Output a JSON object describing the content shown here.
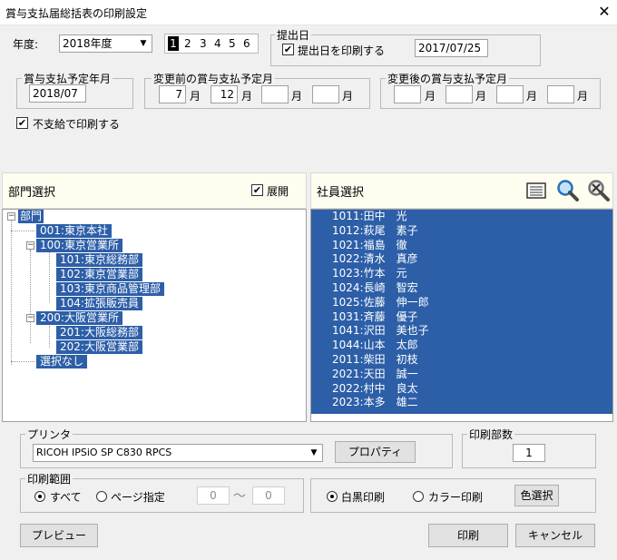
{
  "window": {
    "title": "賞与支払届総括表の印刷設定",
    "close_glyph": "✕"
  },
  "fiscal_year": {
    "label": "年度:",
    "value": "2018年度",
    "pages": [
      "1",
      "2",
      "3",
      "4",
      "5",
      "6"
    ]
  },
  "submission": {
    "group_label": "提出日",
    "print_date_label": "提出日を印刷する",
    "print_date_checked": true,
    "date_value": "2017/07/25"
  },
  "bonus_scheduled": {
    "group_label": "賞与支払予定年月",
    "value": "2018/07"
  },
  "before_change": {
    "group_label": "変更前の賞与支払予定月",
    "months": [
      "7",
      "12",
      "",
      ""
    ],
    "unit": "月"
  },
  "after_change": {
    "group_label": "変更後の賞与支払予定月",
    "months": [
      "",
      "",
      "",
      ""
    ],
    "unit": "月"
  },
  "no_payment": {
    "label": "不支給で印刷する",
    "checked": true
  },
  "department": {
    "title": "部門選択",
    "expand_label": "展開",
    "expand_checked": true,
    "tree": [
      {
        "label": "部門",
        "level": 0,
        "expander": "−"
      },
      {
        "label": "001:東京本社",
        "level": 1
      },
      {
        "label": "100:東京営業所",
        "level": 1,
        "expander": "−"
      },
      {
        "label": "101:東京総務部",
        "level": 2
      },
      {
        "label": "102:東京営業部",
        "level": 2
      },
      {
        "label": "103:東京商品管理部",
        "level": 2
      },
      {
        "label": "104:拡張販売員",
        "level": 2
      },
      {
        "label": "200:大阪営業所",
        "level": 1,
        "expander": "−"
      },
      {
        "label": "201:大阪総務部",
        "level": 2
      },
      {
        "label": "202:大阪営業部",
        "level": 2
      },
      {
        "label": "選択なし",
        "level": 1
      }
    ]
  },
  "employee": {
    "title": "社員選択",
    "icons": [
      "list-icon",
      "search-icon",
      "clear-search-icon"
    ],
    "rows": [
      "1011:田中　光",
      "1012:萩尾　素子",
      "1021:福島　徹",
      "1022:清水　真彦",
      "1023:竹本　元",
      "1024:長崎　智宏",
      "1025:佐藤　伸一郎",
      "1031:斉藤　優子",
      "1041:沢田　美也子",
      "1044:山本　太郎",
      "2011:柴田　初枝",
      "2021:天田　誠一",
      "2022:村中　良太",
      "2023:本多　雄二"
    ]
  },
  "printer": {
    "group_label": "プリンタ",
    "value": "RICOH IPSiO SP C830 RPCS",
    "properties_label": "プロパティ"
  },
  "copies": {
    "group_label": "印刷部数",
    "value": "1"
  },
  "range": {
    "group_label": "印刷範囲",
    "all_label": "すべて",
    "pages_label": "ページ指定",
    "from": "0",
    "to": "0",
    "separator": "〜"
  },
  "color": {
    "mono_label": "白黒印刷",
    "color_label": "カラー印刷",
    "select_label": "色選択"
  },
  "buttons": {
    "preview": "プレビュー",
    "print": "印刷",
    "cancel": "キャンセル"
  },
  "colors": {
    "selection": "#2d5fa8",
    "panel_header": "#fffdf0"
  }
}
